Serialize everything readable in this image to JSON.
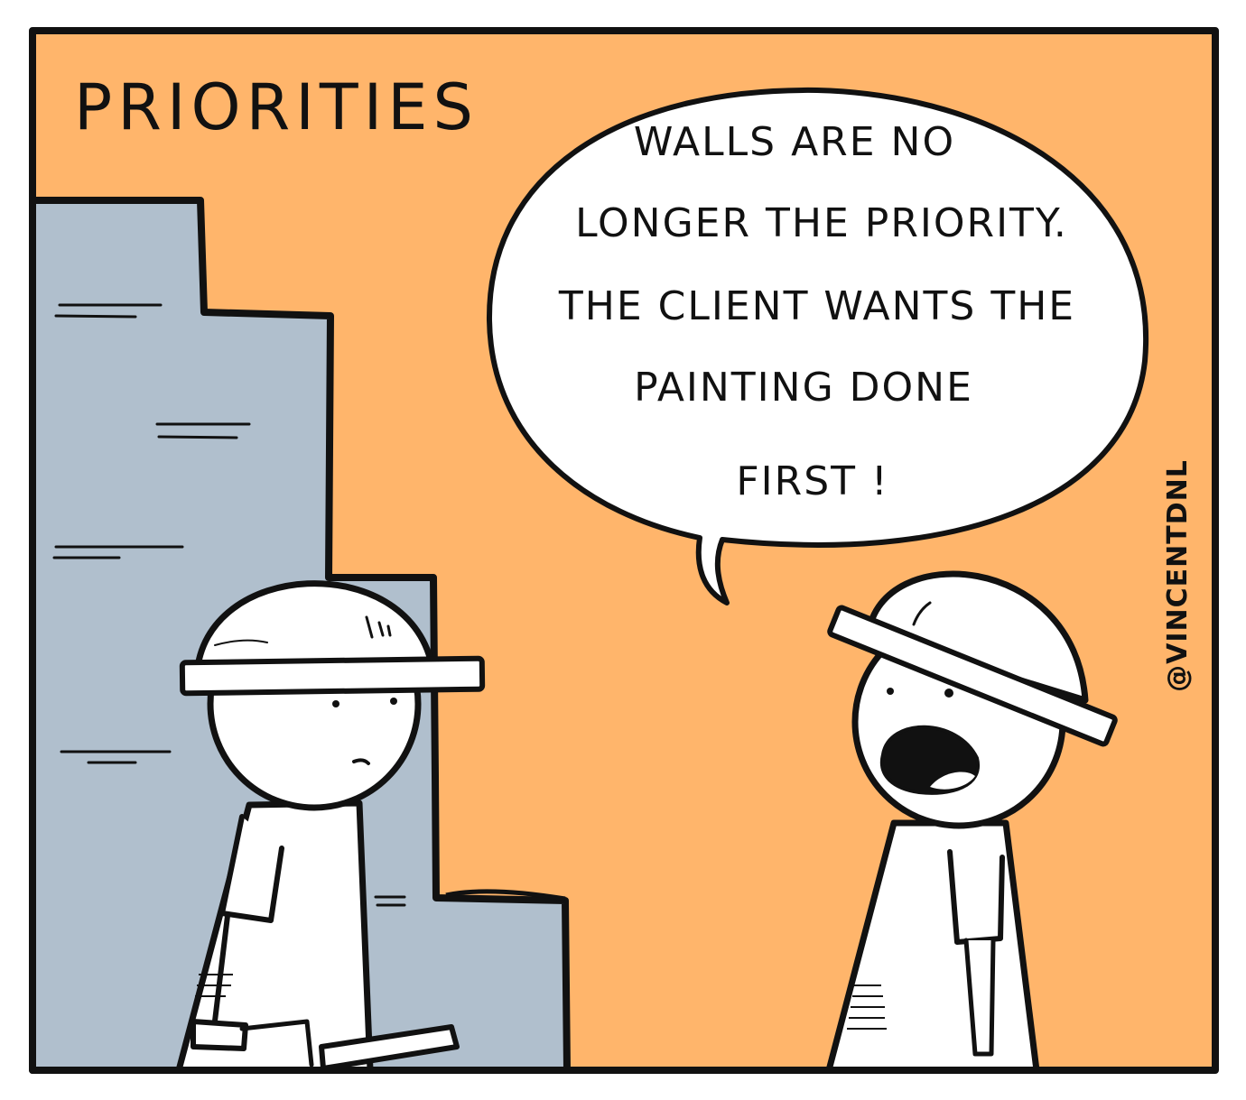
{
  "comic": {
    "title": "PRIORITIES",
    "speech_bubble": {
      "lines": [
        "WALLS ARE NO",
        "LONGER THE PRIORITY.",
        "THE CLIENT WANTS THE",
        "PAINTING DONE",
        "FIRST !"
      ]
    },
    "signature": "@VINCENTDNL",
    "colors": {
      "background": "#ffb56b",
      "wall": "#b0bfcd",
      "outline": "#111111",
      "figure": "#ffffff"
    }
  }
}
